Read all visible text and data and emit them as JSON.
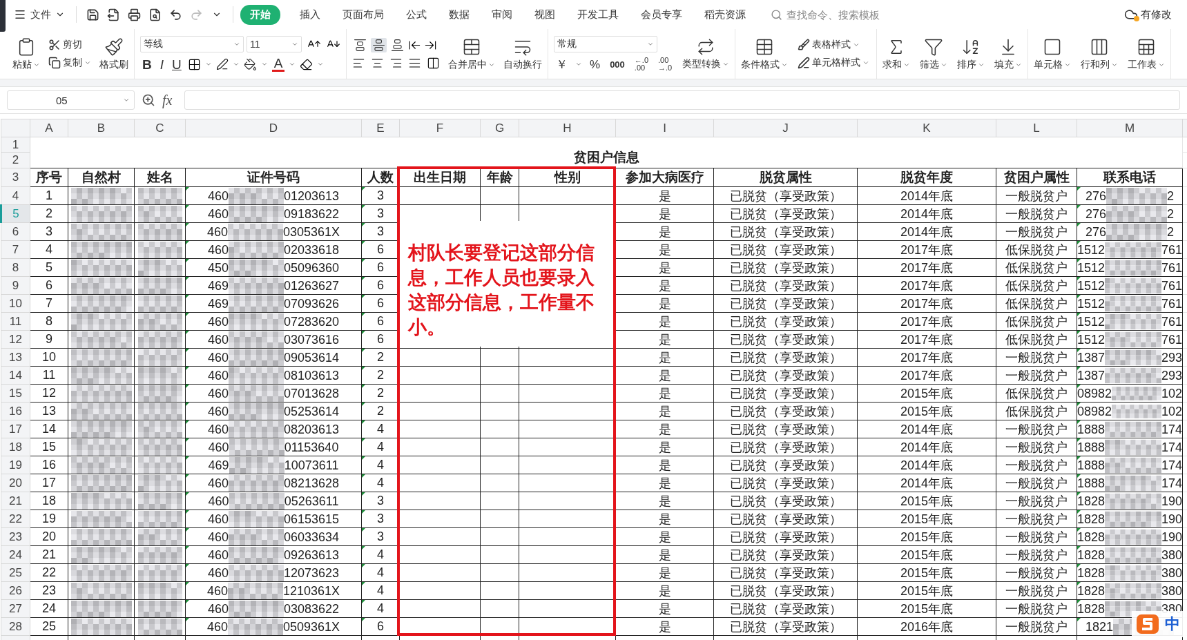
{
  "menu": {
    "file": "文件",
    "quick_access": [
      {
        "kind": "save",
        "disabled": false
      },
      {
        "kind": "export",
        "disabled": false
      },
      {
        "kind": "print",
        "disabled": false
      },
      {
        "kind": "preview",
        "disabled": false
      },
      {
        "kind": "undo",
        "disabled": false
      },
      {
        "kind": "redo",
        "disabled": true
      },
      {
        "kind": "more",
        "disabled": false
      }
    ],
    "tabs": [
      {
        "label": "开始",
        "selected": true
      },
      {
        "label": "插入",
        "selected": false
      },
      {
        "label": "页面布局",
        "selected": false
      },
      {
        "label": "公式",
        "selected": false
      },
      {
        "label": "数据",
        "selected": false
      },
      {
        "label": "审阅",
        "selected": false
      },
      {
        "label": "视图",
        "selected": false
      },
      {
        "label": "开发工具",
        "selected": false
      },
      {
        "label": "会员专享",
        "selected": false
      },
      {
        "label": "稻壳资源",
        "selected": false
      }
    ],
    "search": {
      "placeholder": "查找命令、搜索模板"
    },
    "status": "有修改"
  },
  "ribbon": {
    "clipboard": {
      "paste": "粘贴",
      "cut": "剪切",
      "copy": "复制",
      "format_painter": "格式刷"
    },
    "font": {
      "name": "等线",
      "size": "11",
      "bold": "B",
      "italic": "I",
      "underline": "U",
      "color_letter": "A"
    },
    "vertical_align": [
      {
        "kind": "top",
        "selected": false
      },
      {
        "kind": "middle",
        "selected": true
      },
      {
        "kind": "bottom",
        "selected": false
      }
    ],
    "alignment": {
      "merge": "合并居中",
      "wrap": "自动换行"
    },
    "number": {
      "format": "常规",
      "currency": "￥",
      "percent": "%",
      "thousands": "000",
      "decimal_increase": [
        "←.0",
        ".00"
      ],
      "decimal_decrease": [
        ".00",
        "→.0"
      ],
      "convert": "类型转换"
    },
    "styles": {
      "conditional": "条件格式",
      "table_style": "表格样式",
      "cell_style": "单元格样式"
    },
    "editing": [
      {
        "kind": "sum",
        "label": "求和"
      },
      {
        "kind": "filter",
        "label": "筛选"
      },
      {
        "kind": "sort",
        "label": "排序"
      },
      {
        "kind": "fill",
        "label": "填充"
      }
    ],
    "cells": [
      {
        "kind": "cell",
        "label": "单元格"
      },
      {
        "kind": "rowcol",
        "label": "行和列"
      },
      {
        "kind": "sheet",
        "label": "工作表"
      }
    ]
  },
  "formula_bar": {
    "name_box": "05",
    "fx": "fx"
  },
  "sheet": {
    "columns": [
      "A",
      "B",
      "C",
      "D",
      "E",
      "F",
      "G",
      "H",
      "I",
      "J",
      "K",
      "L",
      "M"
    ],
    "row_numbers": [
      {
        "label": "1",
        "selected": false
      },
      {
        "label": "2",
        "selected": false
      },
      {
        "label": "3",
        "selected": false
      },
      {
        "label": "4",
        "selected": false
      },
      {
        "label": "5",
        "selected": true
      },
      {
        "label": "6",
        "selected": false
      },
      {
        "label": "7",
        "selected": false
      },
      {
        "label": "8",
        "selected": false
      },
      {
        "label": "9",
        "selected": false
      },
      {
        "label": "10",
        "selected": false
      },
      {
        "label": "11",
        "selected": false
      },
      {
        "label": "12",
        "selected": false
      },
      {
        "label": "13",
        "selected": false
      },
      {
        "label": "14",
        "selected": false
      },
      {
        "label": "15",
        "selected": false
      },
      {
        "label": "16",
        "selected": false
      },
      {
        "label": "17",
        "selected": false
      },
      {
        "label": "18",
        "selected": false
      },
      {
        "label": "19",
        "selected": false
      },
      {
        "label": "20",
        "selected": false
      },
      {
        "label": "21",
        "selected": false
      },
      {
        "label": "22",
        "selected": false
      },
      {
        "label": "23",
        "selected": false
      },
      {
        "label": "24",
        "selected": false
      },
      {
        "label": "25",
        "selected": false
      },
      {
        "label": "26",
        "selected": false
      },
      {
        "label": "27",
        "selected": false
      },
      {
        "label": "28",
        "selected": false
      }
    ],
    "title": "贫困户信息",
    "headers": [
      "序号",
      "自然村",
      "姓名",
      "证件号码",
      "人数",
      "出生日期",
      "年龄",
      "性别",
      "参加大病医疗",
      "脱贫属性",
      "脱贫年度",
      "贫困户属性",
      "联系电话"
    ],
    "rows": [
      {
        "no": "1",
        "id_prefix": "460",
        "id_suffix": "01203613",
        "people": "3",
        "medical": "是",
        "status": "已脱贫（享受政策）",
        "year": "2014年底",
        "category": "一般脱贫户",
        "phone_prefix": "276",
        "phone_suffix": "2"
      },
      {
        "no": "2",
        "id_prefix": "460",
        "id_suffix": "09183622",
        "people": "3",
        "medical": "是",
        "status": "已脱贫（享受政策）",
        "year": "2014年底",
        "category": "一般脱贫户",
        "phone_prefix": "276",
        "phone_suffix": "2"
      },
      {
        "no": "3",
        "id_prefix": "460",
        "id_suffix": "0305361X",
        "people": "3",
        "medical": "是",
        "status": "已脱贫（享受政策）",
        "year": "2014年底",
        "category": "一般脱贫户",
        "phone_prefix": "276",
        "phone_suffix": "2"
      },
      {
        "no": "4",
        "id_prefix": "460",
        "id_suffix": "02033618",
        "people": "6",
        "medical": "是",
        "status": "已脱贫（享受政策）",
        "year": "2017年底",
        "category": "低保脱贫户",
        "phone_prefix": "1512",
        "phone_suffix": "761"
      },
      {
        "no": "5",
        "id_prefix": "450",
        "id_suffix": "05096360",
        "people": "6",
        "medical": "是",
        "status": "已脱贫（享受政策）",
        "year": "2017年底",
        "category": "低保脱贫户",
        "phone_prefix": "1512",
        "phone_suffix": "761"
      },
      {
        "no": "6",
        "id_prefix": "469",
        "id_suffix": "01263627",
        "people": "6",
        "medical": "是",
        "status": "已脱贫（享受政策）",
        "year": "2017年底",
        "category": "低保脱贫户",
        "phone_prefix": "1512",
        "phone_suffix": "761"
      },
      {
        "no": "7",
        "id_prefix": "469",
        "id_suffix": "07093626",
        "people": "6",
        "medical": "是",
        "status": "已脱贫（享受政策）",
        "year": "2017年底",
        "category": "低保脱贫户",
        "phone_prefix": "1512",
        "phone_suffix": "761"
      },
      {
        "no": "8",
        "id_prefix": "460",
        "id_suffix": "07283620",
        "people": "6",
        "medical": "是",
        "status": "已脱贫（享受政策）",
        "year": "2017年底",
        "category": "低保脱贫户",
        "phone_prefix": "1512",
        "phone_suffix": "761"
      },
      {
        "no": "9",
        "id_prefix": "460",
        "id_suffix": "03073616",
        "people": "6",
        "medical": "是",
        "status": "已脱贫（享受政策）",
        "year": "2017年底",
        "category": "低保脱贫户",
        "phone_prefix": "1512",
        "phone_suffix": "761"
      },
      {
        "no": "10",
        "id_prefix": "460",
        "id_suffix": "09053614",
        "people": "2",
        "medical": "是",
        "status": "已脱贫（享受政策）",
        "year": "2017年底",
        "category": "一般脱贫户",
        "phone_prefix": "1387",
        "phone_suffix": "293"
      },
      {
        "no": "11",
        "id_prefix": "460",
        "id_suffix": "08103613",
        "people": "2",
        "medical": "是",
        "status": "已脱贫（享受政策）",
        "year": "2017年底",
        "category": "一般脱贫户",
        "phone_prefix": "1387",
        "phone_suffix": "293"
      },
      {
        "no": "12",
        "id_prefix": "460",
        "id_suffix": "07013628",
        "people": "2",
        "medical": "是",
        "status": "已脱贫（享受政策）",
        "year": "2015年底",
        "category": "低保脱贫户",
        "phone_prefix": "08982",
        "phone_suffix": "102"
      },
      {
        "no": "13",
        "id_prefix": "460",
        "id_suffix": "05253614",
        "people": "2",
        "medical": "是",
        "status": "已脱贫（享受政策）",
        "year": "2015年底",
        "category": "低保脱贫户",
        "phone_prefix": "08982",
        "phone_suffix": "102"
      },
      {
        "no": "14",
        "id_prefix": "460",
        "id_suffix": "08203613",
        "people": "4",
        "medical": "是",
        "status": "已脱贫（享受政策）",
        "year": "2014年底",
        "category": "一般脱贫户",
        "phone_prefix": "1888",
        "phone_suffix": "174"
      },
      {
        "no": "15",
        "id_prefix": "460",
        "id_suffix": "01153640",
        "people": "4",
        "medical": "是",
        "status": "已脱贫（享受政策）",
        "year": "2014年底",
        "category": "一般脱贫户",
        "phone_prefix": "1888",
        "phone_suffix": "174"
      },
      {
        "no": "16",
        "id_prefix": "469",
        "id_suffix": "10073611",
        "people": "4",
        "medical": "是",
        "status": "已脱贫（享受政策）",
        "year": "2014年底",
        "category": "一般脱贫户",
        "phone_prefix": "1888",
        "phone_suffix": "174"
      },
      {
        "no": "17",
        "id_prefix": "460",
        "id_suffix": "08213628",
        "people": "4",
        "medical": "是",
        "status": "已脱贫（享受政策）",
        "year": "2014年底",
        "category": "一般脱贫户",
        "phone_prefix": "1888",
        "phone_suffix": "174"
      },
      {
        "no": "18",
        "id_prefix": "460",
        "id_suffix": "05263611",
        "people": "3",
        "medical": "是",
        "status": "已脱贫（享受政策）",
        "year": "2015年底",
        "category": "一般脱贫户",
        "phone_prefix": "1828",
        "phone_suffix": "190"
      },
      {
        "no": "19",
        "id_prefix": "460",
        "id_suffix": "06153615",
        "people": "3",
        "medical": "是",
        "status": "已脱贫（享受政策）",
        "year": "2015年底",
        "category": "一般脱贫户",
        "phone_prefix": "1828",
        "phone_suffix": "190"
      },
      {
        "no": "20",
        "id_prefix": "460",
        "id_suffix": "06033634",
        "people": "3",
        "medical": "是",
        "status": "已脱贫（享受政策）",
        "year": "2015年底",
        "category": "一般脱贫户",
        "phone_prefix": "1828",
        "phone_suffix": "190"
      },
      {
        "no": "21",
        "id_prefix": "460",
        "id_suffix": "09263613",
        "people": "4",
        "medical": "是",
        "status": "已脱贫（享受政策）",
        "year": "2015年底",
        "category": "一般脱贫户",
        "phone_prefix": "1828",
        "phone_suffix": "380"
      },
      {
        "no": "22",
        "id_prefix": "460",
        "id_suffix": "12073623",
        "people": "4",
        "medical": "是",
        "status": "已脱贫（享受政策）",
        "year": "2015年底",
        "category": "一般脱贫户",
        "phone_prefix": "1828",
        "phone_suffix": "380"
      },
      {
        "no": "23",
        "id_prefix": "460",
        "id_suffix": "1210361X",
        "people": "4",
        "medical": "是",
        "status": "已脱贫（享受政策）",
        "year": "2015年底",
        "category": "一般脱贫户",
        "phone_prefix": "1828",
        "phone_suffix": "380"
      },
      {
        "no": "24",
        "id_prefix": "460",
        "id_suffix": "03083622",
        "people": "4",
        "medical": "是",
        "status": "已脱贫（享受政策）",
        "year": "2015年底",
        "category": "一般脱贫户",
        "phone_prefix": "1828",
        "phone_suffix": "380"
      },
      {
        "no": "25",
        "id_prefix": "460",
        "id_suffix": "0509361X",
        "people": "6",
        "medical": "是",
        "status": "已脱贫（享受政策）",
        "year": "2016年底",
        "category": "一般脱贫户",
        "phone_prefix": "1821"
      }
    ]
  },
  "annotation": {
    "text": "村队长要登记这部分信息，工作人员也要录入这部分信息，工作量不小。"
  },
  "ime": {
    "label": "中"
  }
}
